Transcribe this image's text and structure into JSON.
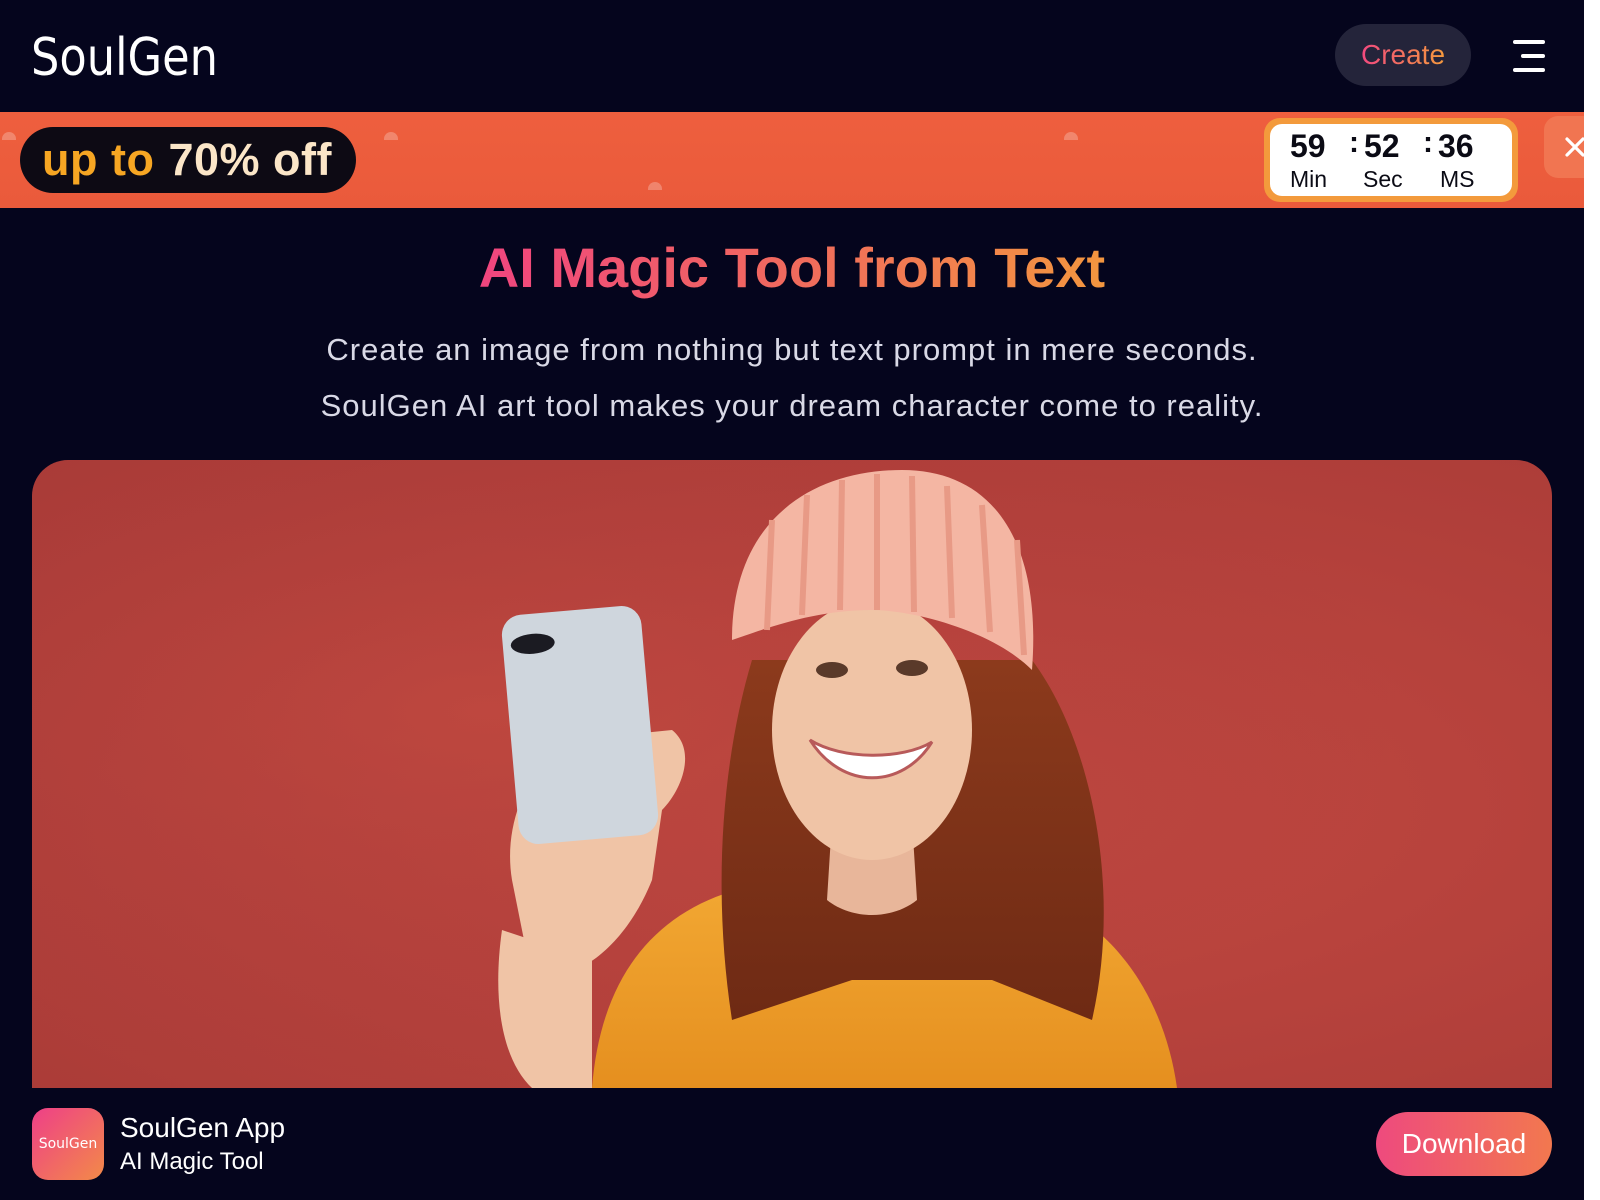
{
  "header": {
    "logo": "SoulGen",
    "create_label": "Create",
    "menu_icon": "hamburger-menu-icon"
  },
  "promo": {
    "prefix": "up to",
    "discount": "70% off",
    "countdown": {
      "minutes": "59",
      "seconds": "52",
      "ms": "36",
      "sep": ":",
      "min_label": "Min",
      "sec_label": "Sec",
      "ms_label": "MS"
    },
    "close_icon": "close-icon",
    "colors": {
      "banner": "#ee5f3e",
      "pill_accent": "#f6a623",
      "timer_border": "#f39a3c"
    }
  },
  "hero": {
    "title": "AI Magic Tool from Text",
    "subtitle_line1": "Create an image from nothing but text prompt in mere seconds.",
    "subtitle_line2": "SoulGen AI art tool makes your dream character come to reality."
  },
  "app_banner": {
    "icon_text": "SoulGen",
    "name": "SoulGen App",
    "desc": "AI Magic Tool",
    "download_label": "Download"
  },
  "colors": {
    "background": "#05051d",
    "accent_pink": "#f0457f",
    "accent_orange": "#f3963f"
  }
}
